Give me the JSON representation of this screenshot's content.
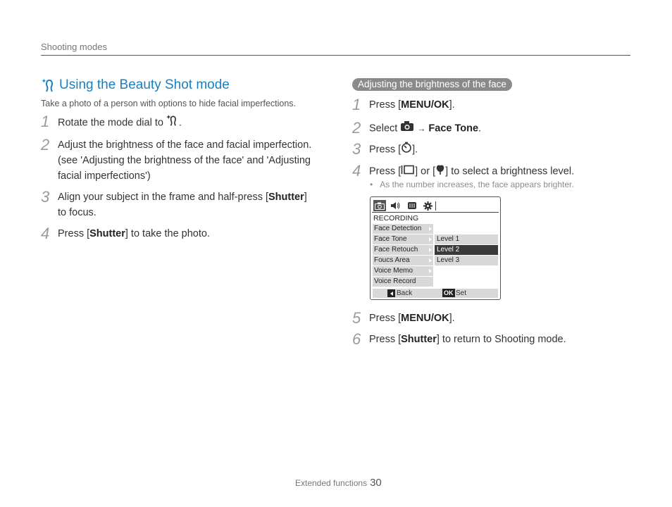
{
  "header": {
    "section": "Shooting modes"
  },
  "left": {
    "title": "Using the Beauty Shot mode",
    "subtitle": "Take a photo of a person with options to hide facial imperfections.",
    "steps": [
      {
        "num": "1",
        "pre": "Rotate the mode dial to",
        "post": "."
      },
      {
        "num": "2",
        "line1": "Adjust the brightness of the face and facial imperfection.",
        "line2": "(see 'Adjusting the brightness of the face' and 'Adjusting",
        "line3": "facial imperfections')"
      },
      {
        "num": "3",
        "pre": "Align your subject in the frame and half-press [",
        "bold": "Shutter",
        "post": "]",
        "line2": "to focus."
      },
      {
        "num": "4",
        "pre": "Press [",
        "bold": "Shutter",
        "post": "] to take the photo."
      }
    ]
  },
  "right": {
    "pill": "Adjusting the brightness of the face",
    "steps": [
      {
        "num": "1",
        "pre": "Press [",
        "bold": "MENU/OK",
        "post": "]."
      },
      {
        "num": "2",
        "pre": "Select",
        "arrow": "→",
        "bold": "Face Tone",
        "post": "."
      },
      {
        "num": "3",
        "pre": "Press [",
        "post": "]."
      },
      {
        "num": "4",
        "pre": "Press [",
        "mid1": "] or [",
        "post": "] to select a brightness level."
      },
      {
        "num": "5",
        "pre": "Press [",
        "bold": "MENU/OK",
        "post": "]."
      },
      {
        "num": "6",
        "pre": "Press [",
        "bold": "Shutter",
        "post": "] to return to Shooting mode."
      }
    ],
    "note": "As the number increases, the face appears brighter.",
    "menu": {
      "heading": "RECORDING",
      "items": [
        "Face Detection",
        "Face Retouch",
        "Face Tone",
        "Foucs Area",
        "Voice Memo",
        "Voice Record"
      ],
      "levels": [
        "Level 1",
        "Level 2",
        "Level 3"
      ],
      "back": "Back",
      "ok_label": "OK",
      "set": "Set"
    }
  },
  "footer": {
    "text": "Extended functions",
    "page": "30"
  },
  "colors": {
    "accent": "#1a7fc0",
    "pill": "#8a8a8a"
  }
}
